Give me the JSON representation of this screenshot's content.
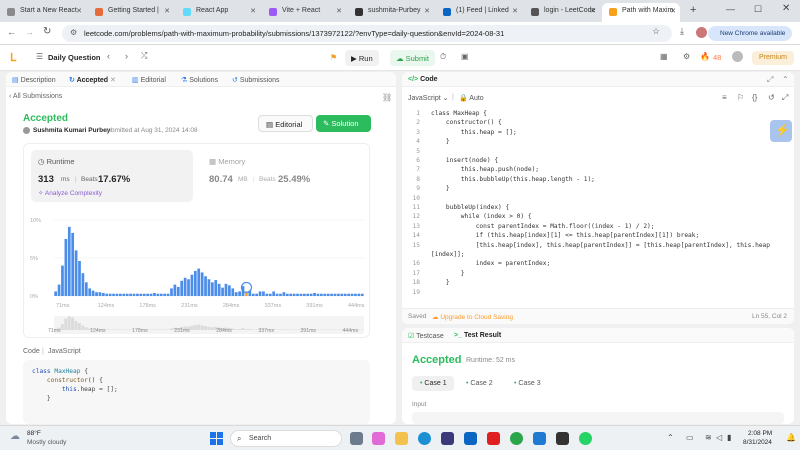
{
  "browser": {
    "tabs": [
      {
        "label": "Start a New React",
        "color": "#8a8a8a"
      },
      {
        "label": "Getting Started |",
        "color": "#e66b3b"
      },
      {
        "label": "React App",
        "color": "#61dafb"
      },
      {
        "label": "Vite + React",
        "color": "#9b59f6"
      },
      {
        "label": "sushmita-Purbey",
        "color": "#333333"
      },
      {
        "label": "(1) Feed | Linked",
        "color": "#0a66c2"
      },
      {
        "label": "login - LeetCode",
        "color": "#555555"
      },
      {
        "label": "Path with Maxim",
        "color": "#f89f1b"
      }
    ],
    "url": "leetcode.com/problems/path-with-maximum-probability/submissions/1373972122/?envType=daily-question&envId=2024-08-31",
    "chrome_notice": "New Chrome available"
  },
  "header": {
    "daily_question": "Daily Question",
    "run": "Run",
    "submit": "Submit",
    "streak": "48",
    "premium": "Premium"
  },
  "left": {
    "tabs": [
      "Description",
      "Accepted",
      "Editorial",
      "Solutions",
      "Submissions"
    ],
    "all_submissions": "All Submissions",
    "status": "Accepted",
    "author": "Sushmita Kumari Purbey",
    "submitted_text": "submitted at Aug 31, 2024 14:08",
    "editorial_btn": "Editorial",
    "solution_btn": "Solution",
    "runtime": {
      "title": "Runtime",
      "value": "313",
      "unit": "ms",
      "beats_label": "Beats",
      "beats": "17.67%",
      "analyze": "Analyze Complexity"
    },
    "memory": {
      "title": "Memory",
      "value": "80.74",
      "unit": "MB",
      "beats_label": "Beats",
      "beats": "25.49%"
    },
    "code_label": "Code",
    "code_lang": "JavaScript",
    "code_lines": [
      "class MaxHeap {",
      "    constructor() {",
      "        this.heap = [];",
      "    }"
    ]
  },
  "chart_data": {
    "type": "bar",
    "ylabel": "",
    "y_ticks": [
      "10%",
      "5%",
      "0%"
    ],
    "ylim": [
      0,
      10
    ],
    "x_tick_labels": [
      "71ms",
      "124ms",
      "178ms",
      "231ms",
      "284ms",
      "337ms",
      "391ms",
      "444ms"
    ],
    "values": [
      0.6,
      1.5,
      4,
      7.5,
      9.1,
      8.3,
      6,
      4.6,
      3,
      1.8,
      1,
      0.7,
      0.5,
      0.5,
      0.4,
      0.3,
      0.3,
      0.3,
      0.3,
      0.3,
      0.3,
      0.3,
      0.3,
      0.3,
      0.3,
      0.3,
      0.3,
      0.3,
      0.3,
      0.4,
      0.3,
      0.3,
      0.3,
      0.3,
      1,
      1.5,
      1.2,
      2,
      2.4,
      2.2,
      2.8,
      3.3,
      3.6,
      3.1,
      2.6,
      2.2,
      1.8,
      2.1,
      1.6,
      1.1,
      1.6,
      1.4,
      1,
      0.5,
      0.6,
      1.3,
      0.6,
      0.7,
      0.3,
      0.3,
      0.6,
      0.6,
      0.3,
      0.3,
      0.6,
      0.3,
      0.3,
      0.5,
      0.3,
      0.3,
      0.3,
      0.3,
      0.3,
      0.3,
      0.3,
      0.3,
      0.4,
      0.3,
      0.3,
      0.3,
      0.3,
      0.3,
      0.3,
      0.3,
      0.3,
      0.3,
      0.3,
      0.3,
      0.3,
      0.3,
      0.3
    ],
    "highlight_index": 56,
    "color": "#4b8de8",
    "highlight_color": "#ffa116"
  },
  "editor": {
    "title": "Code",
    "lang": "JavaScript",
    "auto": "Auto",
    "lines": [
      "class MaxHeap {",
      "    constructor() {",
      "        this.heap = [];",
      "    }",
      "",
      "    insert(node) {",
      "        this.heap.push(node);",
      "        this.bubbleUp(this.heap.length - 1);",
      "    }",
      "",
      "    bubbleUp(index) {",
      "        while (index > 0) {",
      "            const parentIndex = Math.floor((index - 1) / 2);",
      "            if (this.heap[index][1] <= this.heap[parentIndex][1]) break;",
      "            [this.heap[index], this.heap[parentIndex]] = [this.heap[parentIndex], this.heap",
      "[index]];",
      "            index = parentIndex;",
      "        }",
      "    }",
      ""
    ],
    "line_numbers": [
      "1",
      "2",
      "3",
      "4",
      "5",
      "6",
      "7",
      "8",
      "9",
      "10",
      "11",
      "12",
      "13",
      "14",
      "15",
      "",
      "16",
      "17",
      "18",
      "19"
    ],
    "saved": "Saved",
    "upgrade": "Upgrade to Cloud Saving",
    "cursor": "Ln 55, Col 2"
  },
  "results": {
    "tab_testcase": "Testcase",
    "tab_result": "Test Result",
    "status": "Accepted",
    "runtime": "Runtime: 52 ms",
    "cases": [
      "Case 1",
      "Case 2",
      "Case 3"
    ],
    "input_label": "Input"
  },
  "taskbar": {
    "weather_temp": "88°F",
    "weather_desc": "Mostly cloudy",
    "search": "Search",
    "time": "2:08 PM",
    "date": "8/31/2024"
  }
}
